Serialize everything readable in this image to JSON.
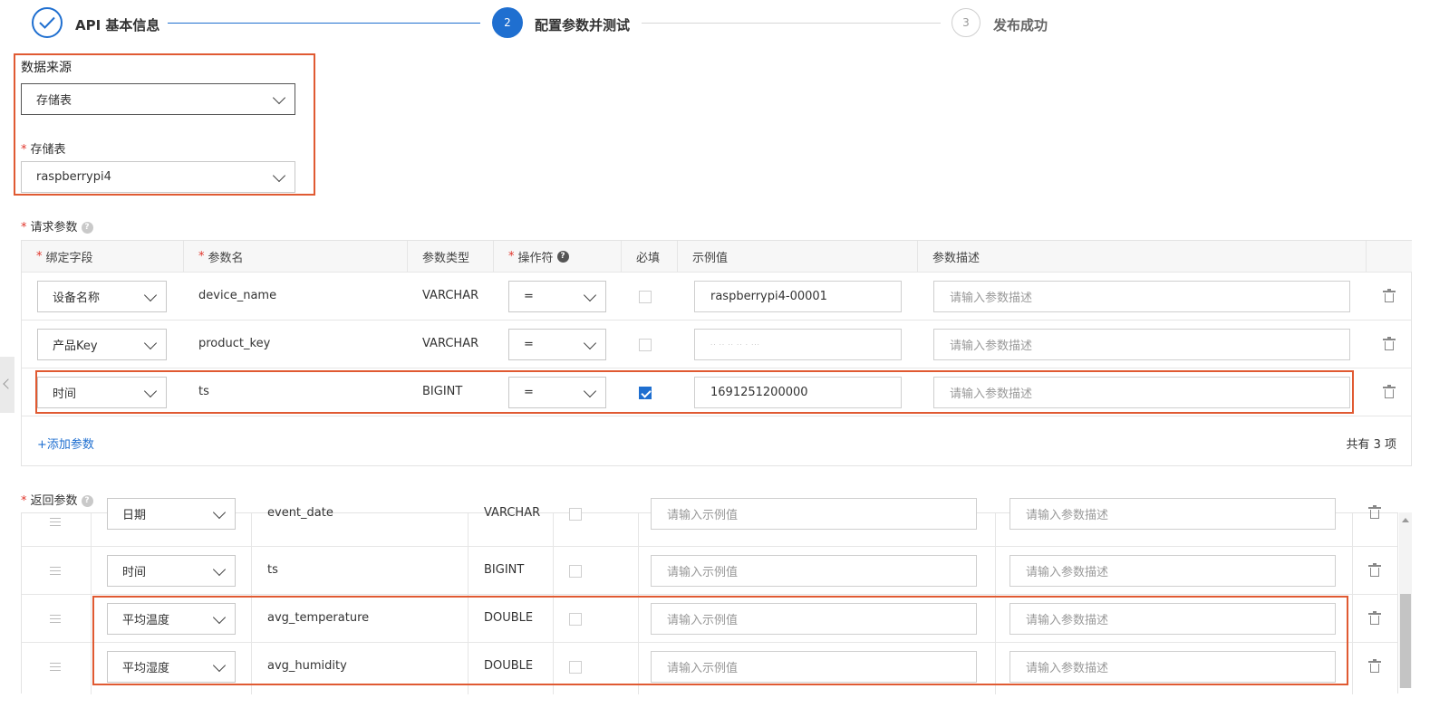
{
  "stepper": {
    "steps": [
      {
        "label": "API 基本信息",
        "state": "done"
      },
      {
        "label": "配置参数并测试",
        "number": "2",
        "state": "active"
      },
      {
        "label": "发布成功",
        "number": "3",
        "state": "todo"
      }
    ]
  },
  "data_source": {
    "label": "数据来源",
    "value": "存储表",
    "table_label": "存储表",
    "table_value": "raspberrypi4"
  },
  "request_params": {
    "title": "请求参数",
    "headers": [
      "绑定字段",
      "参数名",
      "参数类型",
      "操作符",
      "必填",
      "示例值",
      "参数描述"
    ],
    "rows": [
      {
        "field": "设备名称",
        "name": "device_name",
        "type": "VARCHAR",
        "operator": "=",
        "required": false,
        "example": "raspberrypi4-00001",
        "desc_placeholder": "请输入参数描述"
      },
      {
        "field": "产品Key",
        "name": "product_key",
        "type": "VARCHAR",
        "operator": "=",
        "required": false,
        "example": "·· ·· ·· ·· · ···",
        "desc_placeholder": "请输入参数描述"
      },
      {
        "field": "时间",
        "name": "ts",
        "type": "BIGINT",
        "operator": "=",
        "required": true,
        "example": "1691251200000",
        "desc_placeholder": "请输入参数描述"
      }
    ],
    "add_link": "+添加参数",
    "total": "共有 3 项"
  },
  "response_params": {
    "title": "返回参数",
    "rows": [
      {
        "field": "日期",
        "name": "event_date",
        "type": "VARCHAR",
        "example_placeholder": "请输入示例值",
        "desc_placeholder": "请输入参数描述"
      },
      {
        "field": "时间",
        "name": "ts",
        "type": "BIGINT",
        "example_placeholder": "请输入示例值",
        "desc_placeholder": "请输入参数描述"
      },
      {
        "field": "平均温度",
        "name": "avg_temperature",
        "type": "DOUBLE",
        "example_placeholder": "请输入示例值",
        "desc_placeholder": "请输入参数描述"
      },
      {
        "field": "平均湿度",
        "name": "avg_humidity",
        "type": "DOUBLE",
        "example_placeholder": "请输入示例值",
        "desc_placeholder": "请输入参数描述"
      }
    ]
  },
  "colors": {
    "primary": "#1f6fd0",
    "highlight": "#e05a32",
    "required": "#e0342a"
  }
}
